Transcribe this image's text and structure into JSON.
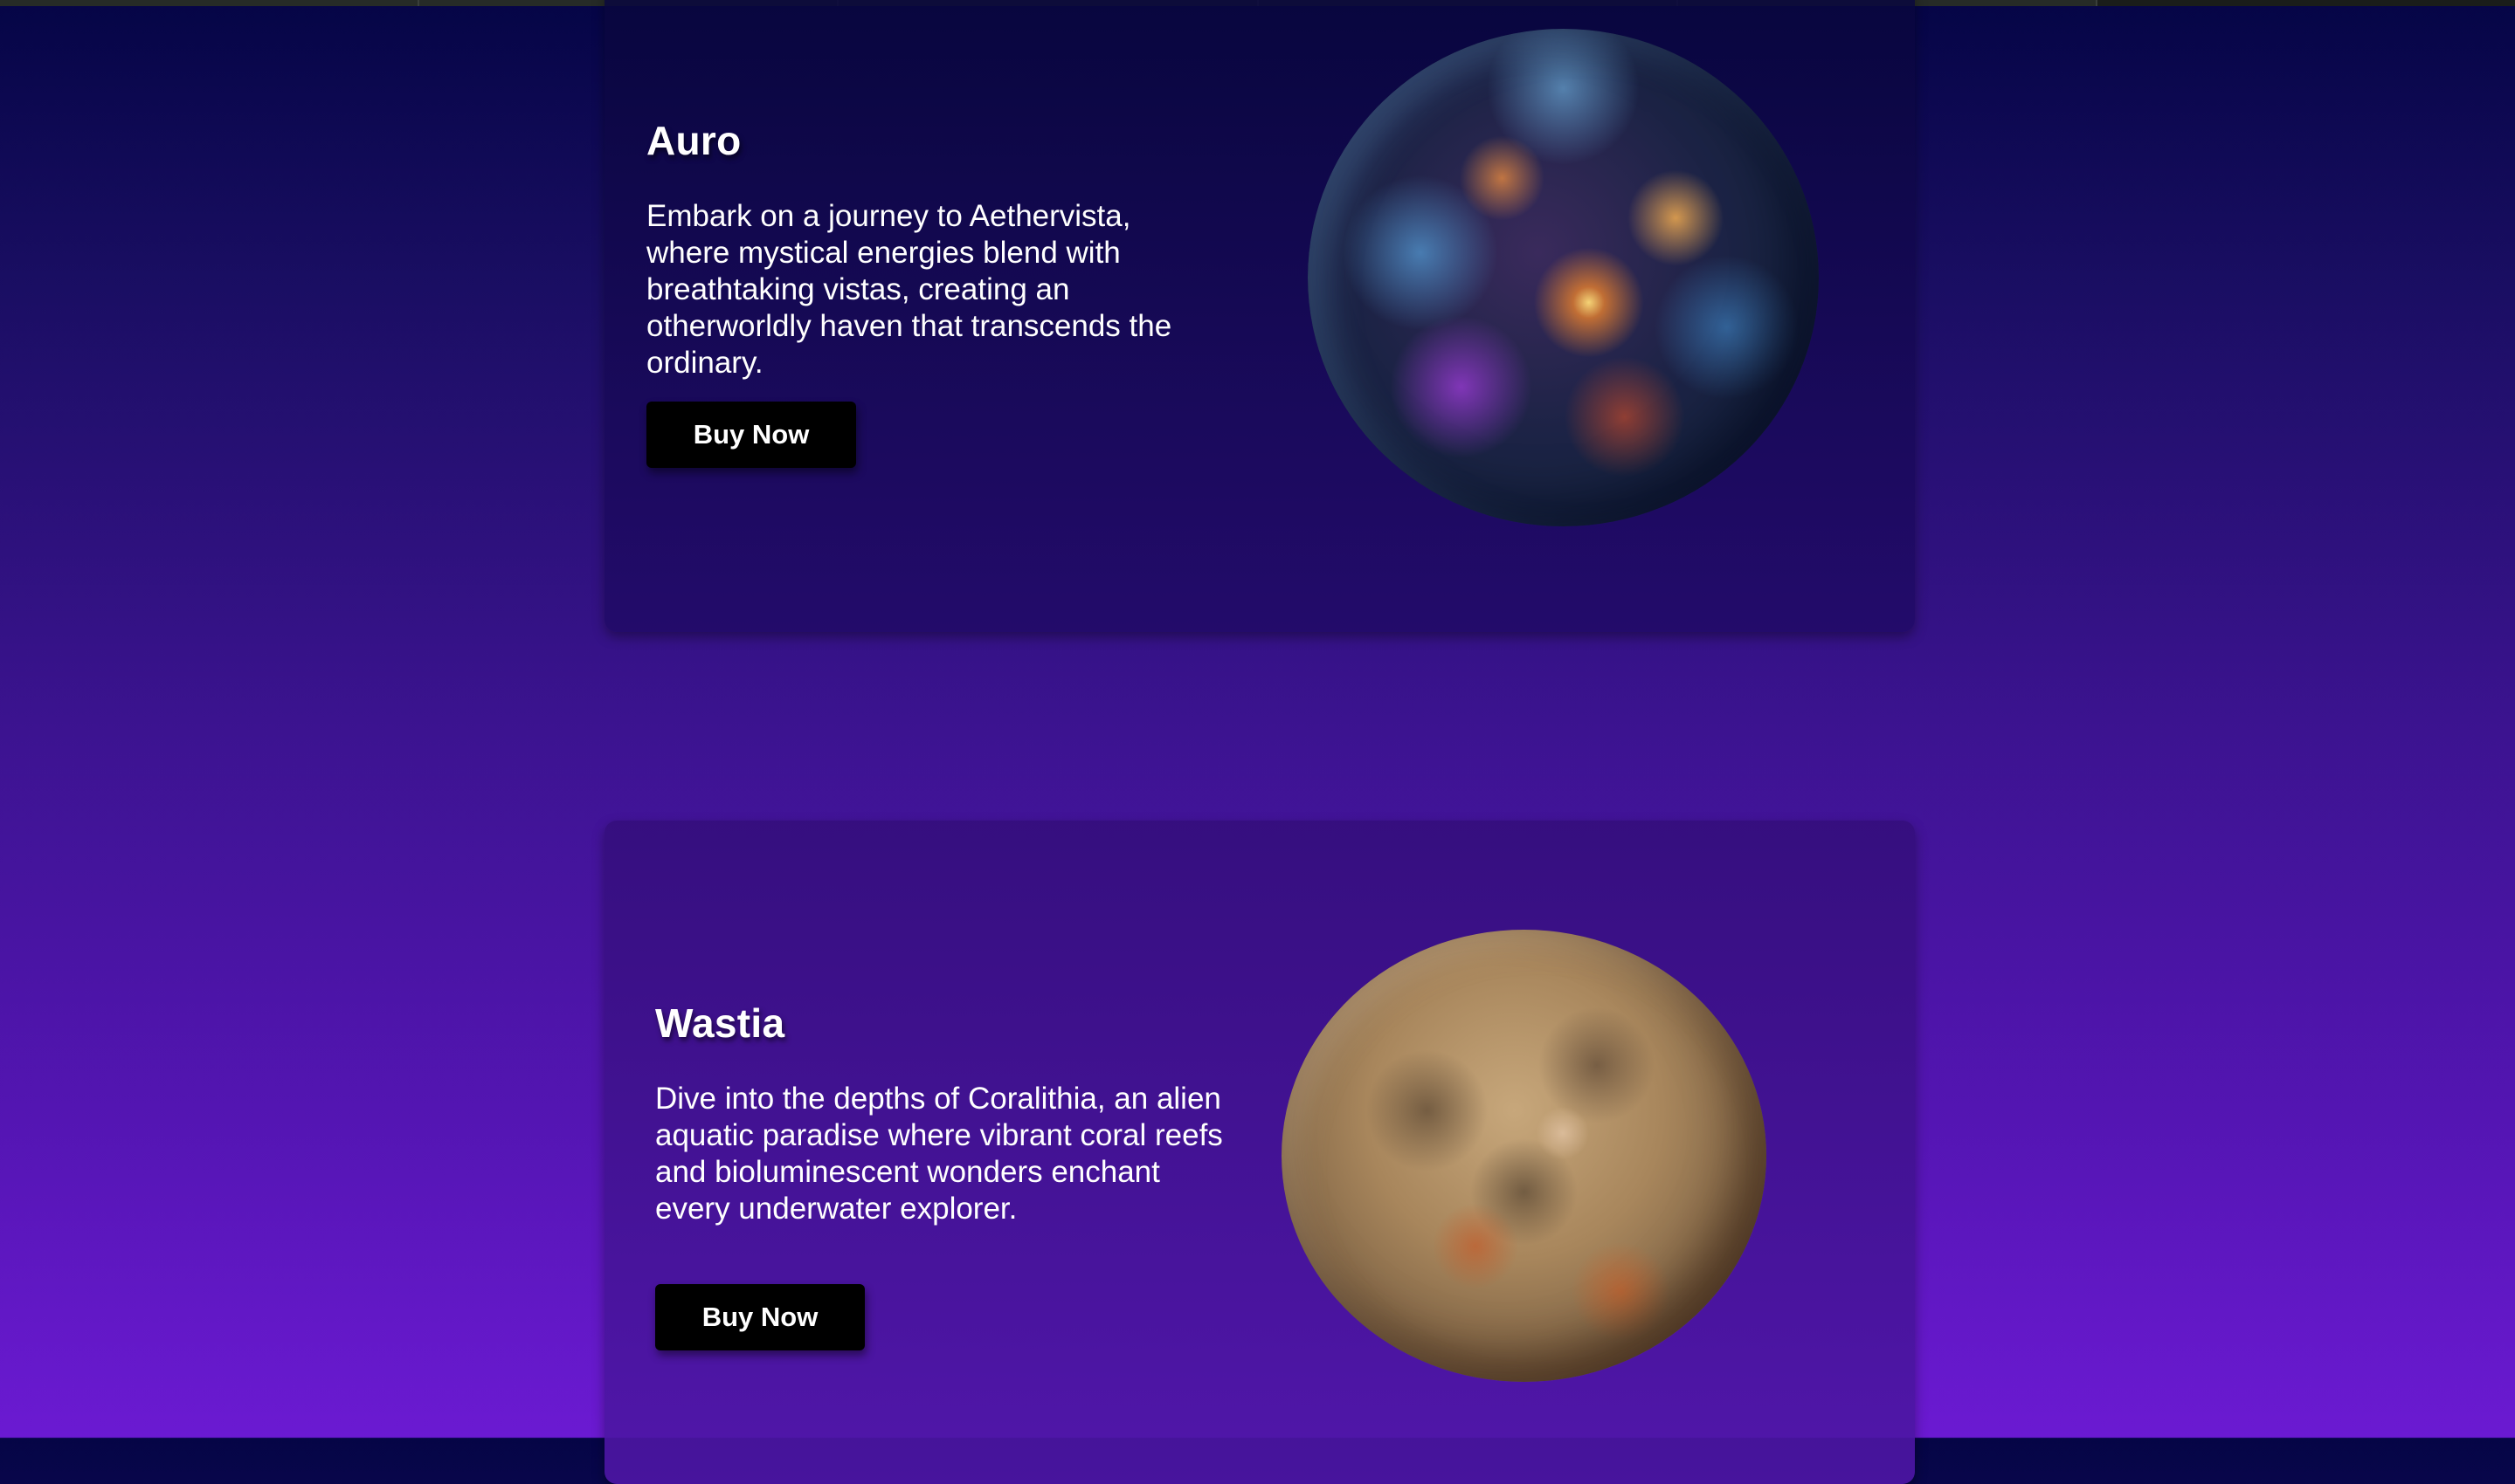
{
  "products": [
    {
      "title": "Auro",
      "description": "Embark on a journey to Aethervista, where mystical energies blend with breathtaking vistas, creating an otherworldly haven that transcends the ordinary.",
      "button_label": "Buy Now"
    },
    {
      "title": "Wastia",
      "description": "Dive into the depths of Coralithia, an alien aquatic paradise where vibrant coral reefs and bioluminescent wonders enchant every underwater explorer.",
      "button_label": "Buy Now"
    }
  ],
  "colors": {
    "background_top": "#050546",
    "background_bottom": "#6b1ad2",
    "button_bg": "#000000",
    "text": "#ffffff"
  }
}
